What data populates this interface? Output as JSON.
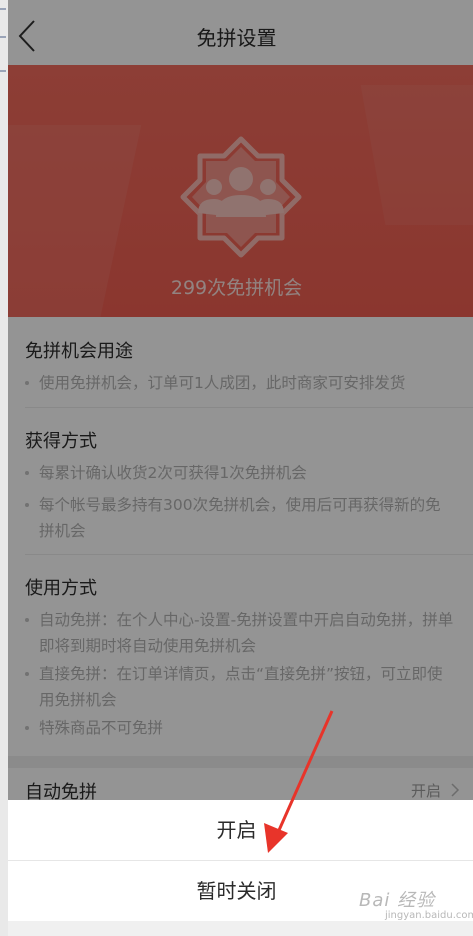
{
  "header": {
    "title": "免拼设置"
  },
  "hero": {
    "text": "299次免拼机会"
  },
  "sections": {
    "usage": {
      "title": "免拼机会用途",
      "items": [
        "使用免拼机会，订单可1人成团，此时商家可安排发货"
      ]
    },
    "obtain": {
      "title": "获得方式",
      "items": [
        "每累计确认收货2次可获得1次免拼机会",
        "每个帐号最多持有300次免拼机会，使用后可再获得新的免拼机会"
      ]
    },
    "how": {
      "title": "使用方式",
      "items": [
        "自动免拼：在个人中心-设置-免拼设置中开启自动免拼，拼单即将到期时将自动使用免拼机会",
        "直接免拼：在订单详情页，点击“直接免拼”按钮，可立即使用免拼机会",
        "特殊商品不可免拼"
      ]
    }
  },
  "auto": {
    "label": "自动免拼",
    "value": "开启"
  },
  "sheet": {
    "enable": "开启",
    "disable": "暂时关闭"
  },
  "watermark": {
    "text": "Bai 经验",
    "sub": "jingyan.baidu.com"
  },
  "colors": {
    "hero": "#ef5e51",
    "arrow": "#e8342a"
  }
}
